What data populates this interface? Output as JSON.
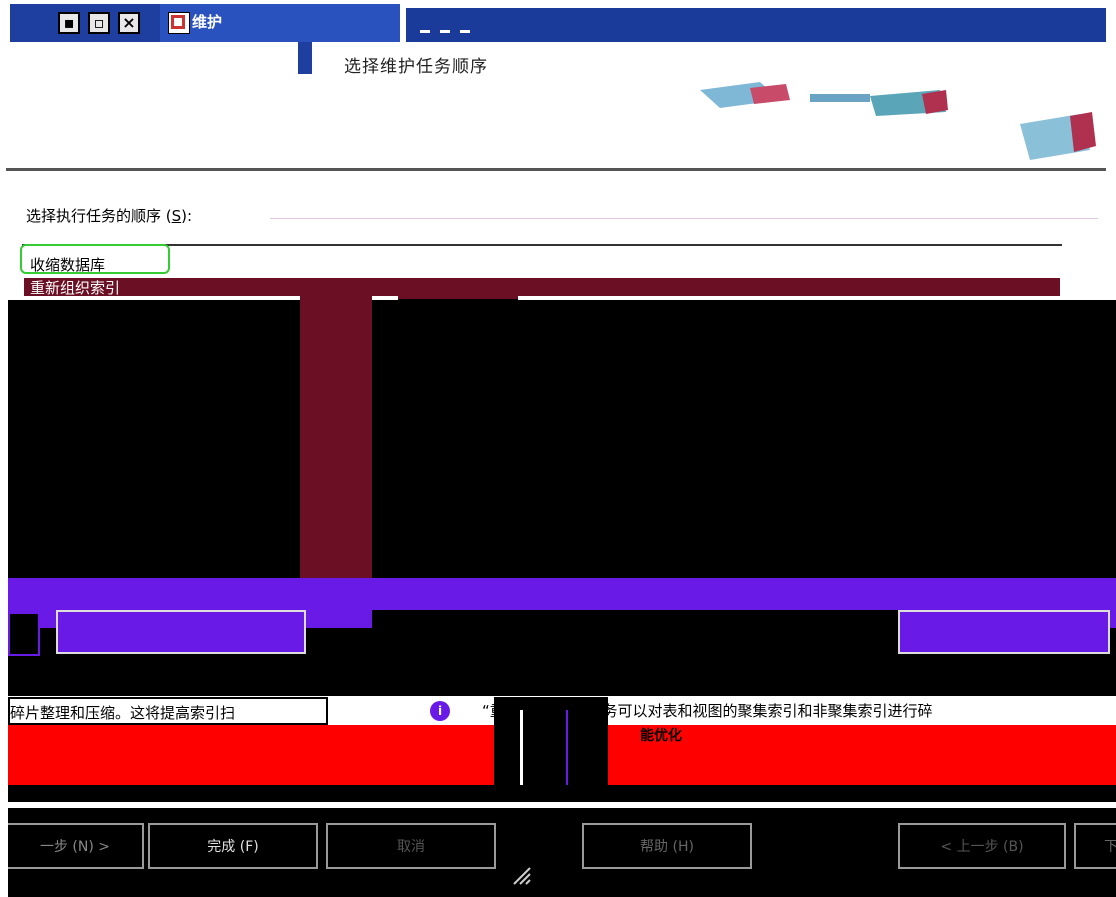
{
  "window": {
    "title": "维护",
    "controls": {
      "minimize_icon": "minimize-icon",
      "maximize_icon": "maximize-icon",
      "close_glyph": "×"
    }
  },
  "header": {
    "title": "选择维护任务顺序"
  },
  "order_label": {
    "text_before": "选择执行任务的顺序 (",
    "accelerator": "S",
    "text_after": "):"
  },
  "task_list": {
    "items": [
      {
        "label": "收缩数据库",
        "selected": false
      },
      {
        "label": "重新组织索引",
        "selected": true
      }
    ]
  },
  "description": {
    "left_text": "碎片整理和压缩。这将提高索引扫",
    "right_text": "“重新组织索引”任务可以对表和视图的聚集索引和非聚集索引进行碎",
    "right_continuation": "能优化",
    "info_icon": "info-icon",
    "info_glyph": "i"
  },
  "buttons": {
    "next_partial": "一步 (N) >",
    "finish": "完成 (F)",
    "cancel": "取消",
    "help": "帮助 (H)",
    "back": "< 上一步 (B)",
    "next_right_partial": "下"
  },
  "colors": {
    "title_blue": "#1f3fa0",
    "selection_maroon": "#6b0f24",
    "glitch_purple": "#6a1ae6",
    "glitch_red": "#ff0000",
    "focus_green": "#33cc33"
  }
}
